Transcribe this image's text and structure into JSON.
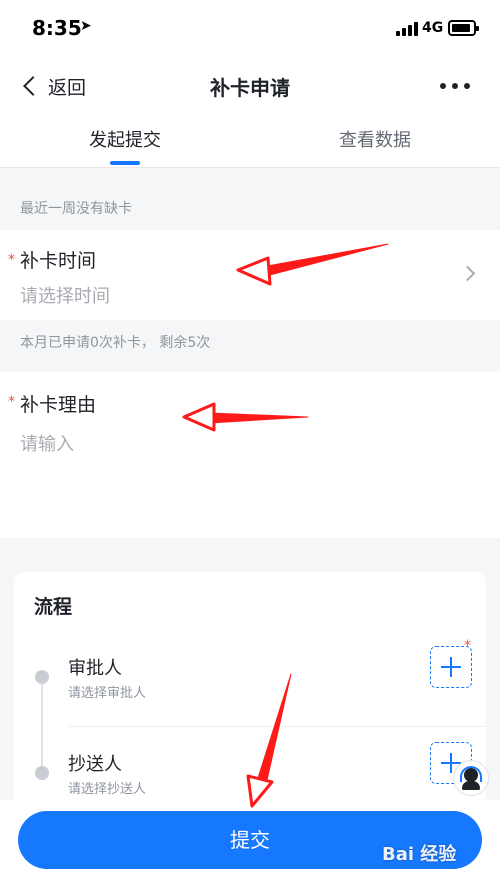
{
  "status_bar": {
    "time": "8:35",
    "network": "4G"
  },
  "nav": {
    "back_label": "返回",
    "title": "补卡申请"
  },
  "tabs": [
    {
      "label": "发起提交",
      "active": true
    },
    {
      "label": "查看数据",
      "active": false
    }
  ],
  "notices": {
    "week": "最近一周没有缺卡",
    "month": "本月已申请0次补卡， 剩余5次"
  },
  "form": {
    "time": {
      "required_mark": "*",
      "label": "补卡时间",
      "placeholder": "请选择时间"
    },
    "reason": {
      "required_mark": "*",
      "label": "补卡理由",
      "placeholder": "请输入"
    }
  },
  "flow": {
    "title": "流程",
    "steps": [
      {
        "name": "审批人",
        "hint": "请选择审批人",
        "required_mark": "*"
      },
      {
        "name": "抄送人",
        "hint": "请选择抄送人"
      }
    ]
  },
  "submit_label": "提交",
  "watermark": "Bai 经验",
  "colors": {
    "accent": "#1677ff",
    "required": "#f54a45",
    "annotation": "#ff1a1a"
  }
}
